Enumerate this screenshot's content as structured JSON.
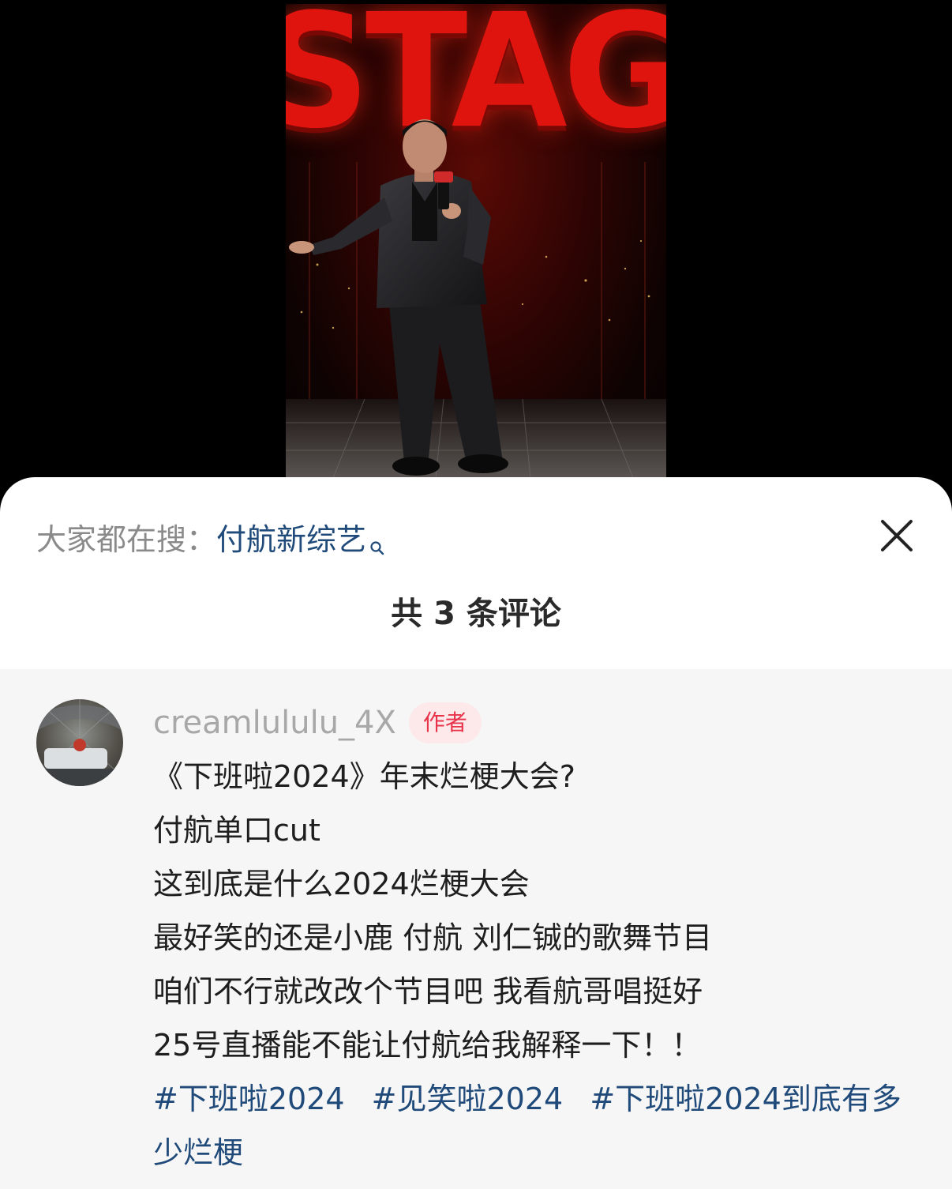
{
  "video": {
    "stage_sign": "STAGE"
  },
  "sheet": {
    "search_prefix": "大家都在搜：",
    "search_term": "付航新综艺",
    "comment_count": "共 3 条评论"
  },
  "comment": {
    "username": "creamlululu_4X",
    "badge": "作者",
    "lines": [
      "《下班啦2024》年末烂梗大会?",
      "付航单口cut",
      "这到底是什么2024烂梗大会",
      "最好笑的还是小鹿 付航 刘仁铖的歌舞节目",
      "咱们不行就改改个节目吧 我看航哥唱挺好",
      "25号直播能不能让付航给我解释一下！！"
    ],
    "hashtags": [
      "#下班啦2024",
      "#见笑啦2024",
      "#下班啦2024到底有多少烂梗"
    ]
  },
  "colors": {
    "link": "#1f4a7a",
    "badge_bg": "#fde8ea",
    "badge_text": "#e8334a",
    "muted": "#8a8a8a"
  },
  "icons": {
    "search": "search-icon",
    "close": "close-icon"
  }
}
